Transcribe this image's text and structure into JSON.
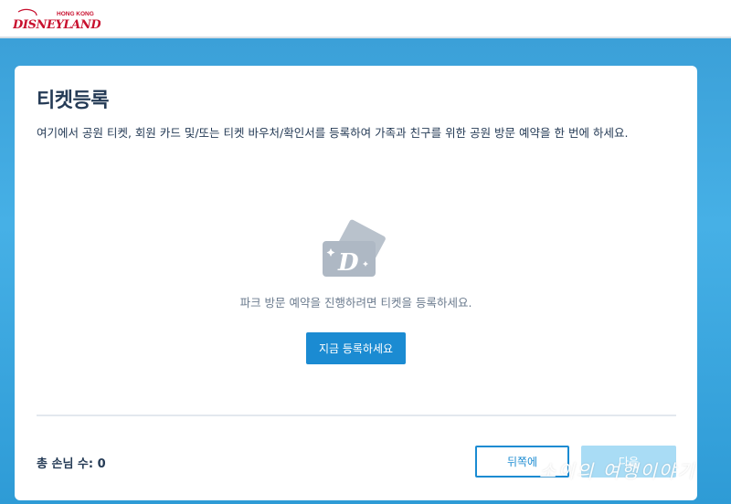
{
  "header": {
    "logo": {
      "small_text": "HONG KONG",
      "main_text": "DISNEYLAND",
      "icon": "disneyland-logo"
    }
  },
  "card": {
    "title": "티켓등록",
    "description": "여기에서 공원 티켓, 회원 카드 및/또는 티켓 바우처/확인서를 등록하여 가족과 친구를 위한 공원 방문 예약을 한 번에 하세요.",
    "empty_state": {
      "icon": "tickets-icon",
      "message": "파크 방문 예약을 진행하려면 티켓을 등록하세요.",
      "register_button": "지금 등록하세요"
    },
    "footer": {
      "guest_count_label": "총 손님 수: 0",
      "back_button": "뒤쪽에",
      "next_button": "다음"
    }
  },
  "watermark": "소이의 여행이야기",
  "colors": {
    "accent": "#1b8bd2",
    "title": "#253b56",
    "background_blue": "#3ba0d8",
    "disabled_button": "#a9dcf5",
    "logo_red": "#c8102e"
  }
}
